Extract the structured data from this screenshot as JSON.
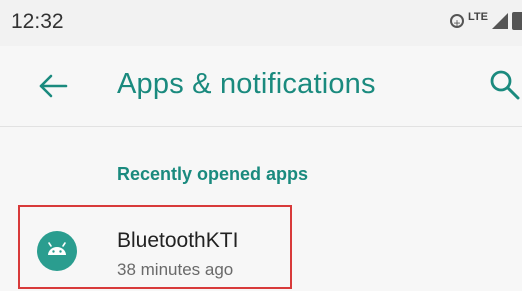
{
  "status_bar": {
    "time": "12:32",
    "network_label": "LTE",
    "icons": [
      "data-saver-icon",
      "signal-icon",
      "battery-icon"
    ]
  },
  "app_bar": {
    "title": "Apps & notifications",
    "back_icon": "back-arrow-icon",
    "search_icon": "search-icon",
    "accent_color": "#1a8a7e"
  },
  "recent_apps": {
    "header": "Recently opened apps",
    "items": [
      {
        "name": "BluetoothKTI",
        "subtitle": "38 minutes ago",
        "icon": "android-icon",
        "icon_color": "#2a9d8f",
        "highlight_color": "#d83a3a"
      }
    ]
  }
}
